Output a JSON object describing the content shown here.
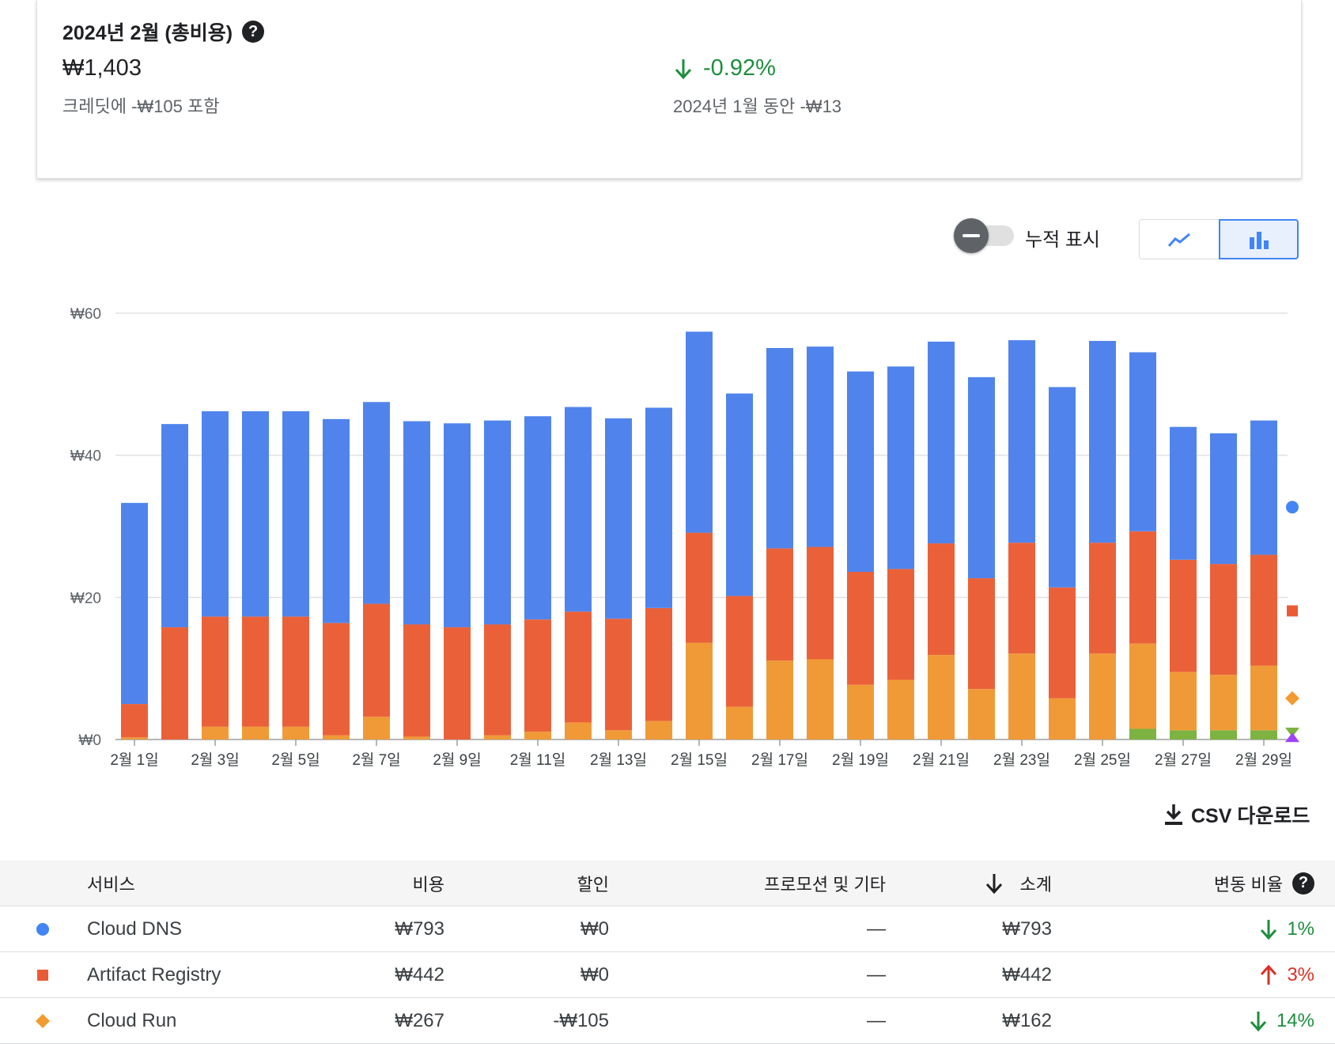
{
  "summary": {
    "title": "2024년 2월 (총비용)",
    "total": "₩1,403",
    "credit_note": "크레딧에 -₩105 포함",
    "change": "-0.92%",
    "previous": "2024년 1월 동안 -₩13",
    "help_icon": "help-icon"
  },
  "controls": {
    "cumulative_label": "누적 표시",
    "cumulative_on": false,
    "view_line_icon": "line-chart-icon",
    "view_bar_icon": "bar-chart-icon",
    "selected_view": "bar"
  },
  "chart_data": {
    "type": "bar",
    "stacked": true,
    "categories": [
      "2월 1일",
      "2월 2일",
      "2월 3일",
      "2월 4일",
      "2월 5일",
      "2월 6일",
      "2월 7일",
      "2월 8일",
      "2월 9일",
      "2월 10일",
      "2월 11일",
      "2월 12일",
      "2월 13일",
      "2월 14일",
      "2월 15일",
      "2월 16일",
      "2월 17일",
      "2월 18일",
      "2월 19일",
      "2월 20일",
      "2월 21일",
      "2월 22일",
      "2월 23일",
      "2월 24일",
      "2월 25일",
      "2월 26일",
      "2월 27일",
      "2월 28일",
      "2월 29일"
    ],
    "tick_labels": [
      "2월 1일",
      "2월 3일",
      "2월 5일",
      "2월 7일",
      "2월 9일",
      "2월 11일",
      "2월 13일",
      "2월 15일",
      "2월 17일",
      "2월 19일",
      "2월 21일",
      "2월 23일",
      "2월 25일",
      "2월 27일",
      "2월 29일"
    ],
    "y_tick_labels": [
      "₩0",
      "₩20",
      "₩40",
      "₩60"
    ],
    "y_ticks": [
      0,
      20,
      40,
      60
    ],
    "ylim": [
      0,
      60
    ],
    "series": [
      {
        "key": "other",
        "color": "#7cb342",
        "values": [
          0,
          0,
          0,
          0,
          0,
          0,
          0,
          0,
          0,
          0,
          0,
          0,
          0,
          0,
          0,
          0,
          0,
          0,
          0,
          0,
          0,
          0,
          0,
          0,
          0,
          1.5,
          1.3,
          1.3,
          1.3
        ]
      },
      {
        "key": "run",
        "color": "#f09a37",
        "values": [
          0.3,
          0,
          1.8,
          1.8,
          1.8,
          0.6,
          3.2,
          0.4,
          0,
          0.6,
          1.1,
          2.4,
          1.3,
          2.6,
          13.6,
          4.6,
          11.1,
          11.3,
          7.7,
          8.4,
          11.9,
          7.1,
          12.1,
          5.8,
          12.1,
          12.0,
          8.2,
          7.8,
          9.1
        ]
      },
      {
        "key": "registry",
        "color": "#ea6139",
        "values": [
          4.7,
          15.8,
          15.5,
          15.5,
          15.5,
          15.8,
          15.9,
          15.8,
          15.8,
          15.6,
          15.8,
          15.6,
          15.7,
          15.9,
          15.5,
          15.6,
          15.8,
          15.8,
          15.9,
          15.6,
          15.7,
          15.6,
          15.6,
          15.6,
          15.6,
          15.8,
          15.8,
          15.6,
          15.6
        ]
      },
      {
        "key": "dns",
        "color": "#5084ec",
        "values": [
          28.3,
          28.6,
          28.9,
          28.9,
          28.9,
          28.7,
          28.4,
          28.6,
          28.7,
          28.7,
          28.6,
          28.8,
          28.2,
          28.2,
          28.3,
          28.5,
          28.2,
          28.2,
          28.2,
          28.5,
          28.4,
          28.3,
          28.5,
          28.2,
          28.4,
          25.2,
          18.7,
          18.4,
          18.9
        ]
      }
    ],
    "legend_markers": [
      {
        "shape": "circle",
        "color": "#4285f4",
        "value": 32.7
      },
      {
        "shape": "square",
        "color": "#ea5b35",
        "value": 18.1
      },
      {
        "shape": "diamond",
        "color": "#f29b30",
        "value": 5.8
      },
      {
        "shape": "triangle-down",
        "color": "#7cb342",
        "value": 1.0
      },
      {
        "shape": "triangle-up",
        "color": "#a142f4",
        "value": 0.3
      }
    ]
  },
  "csv": {
    "label": "CSV 다운로드",
    "icon": "download-icon"
  },
  "table": {
    "headers": {
      "service": "서비스",
      "cost": "비용",
      "discount": "할인",
      "promo": "프로모션 및 기타",
      "subtotal": "소계",
      "change": "변동 비율"
    },
    "sort_icon": "arrow-down-icon",
    "rows": [
      {
        "marker": "circle",
        "color": "#4285f4",
        "service": "Cloud DNS",
        "cost": "₩793",
        "discount": "₩0",
        "promo": "—",
        "subtotal": "₩793",
        "change": "1%",
        "direction": "down"
      },
      {
        "marker": "square",
        "color": "#ea5b35",
        "service": "Artifact Registry",
        "cost": "₩442",
        "discount": "₩0",
        "promo": "—",
        "subtotal": "₩442",
        "change": "3%",
        "direction": "up"
      },
      {
        "marker": "diamond",
        "color": "#f29b30",
        "service": "Cloud Run",
        "cost": "₩267",
        "discount": "-₩105",
        "promo": "—",
        "subtotal": "₩162",
        "change": "14%",
        "direction": "down"
      }
    ]
  }
}
